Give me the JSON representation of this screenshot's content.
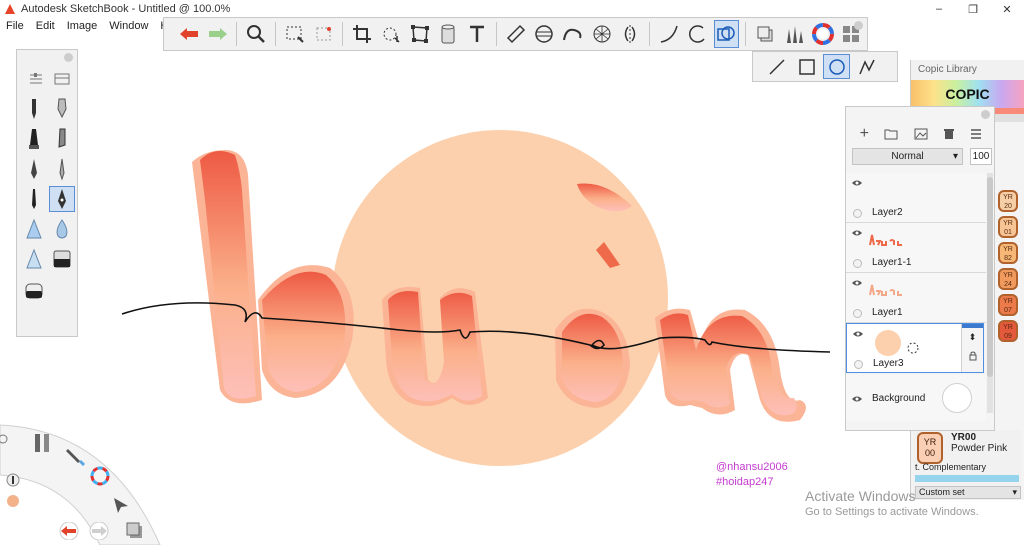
{
  "window": {
    "title": "Autodesk SketchBook - Untitled @ 100.0%",
    "controls": [
      "–",
      "❐",
      "✕"
    ]
  },
  "menu": [
    "File",
    "Edit",
    "Image",
    "Window",
    "Help"
  ],
  "toolbar": {
    "tools": [
      "undo-icon",
      "redo-icon",
      "zoom-icon",
      "rect-select-icon",
      "lasso-select-icon",
      "crop-icon",
      "transform-icon",
      "distort-icon",
      "fill-icon",
      "text-icon",
      "ruler-icon",
      "ellipse-guide-icon",
      "french-curve-icon",
      "perspective-icon",
      "symmetry-icon",
      "stroke-icon",
      "circle-icon",
      "shape-icon",
      "copy-icon",
      "brush-library-icon",
      "color-wheel-icon",
      "palette-grid-icon"
    ],
    "active_tool": "shape-icon",
    "shape_options": [
      "line",
      "rectangle",
      "ellipse",
      "polyline"
    ],
    "active_shape": "ellipse"
  },
  "copic": {
    "header": "Copic Library",
    "logo": "COPIC",
    "swatches": [
      {
        "code": "YR",
        "num": "20",
        "color": "#f6cfa6"
      },
      {
        "code": "YR",
        "num": "01",
        "color": "#f7c495"
      },
      {
        "code": "YR",
        "num": "82",
        "color": "#f6b777"
      },
      {
        "code": "YR",
        "num": "24",
        "color": "#f09a5e"
      },
      {
        "code": "YR",
        "num": "07",
        "color": "#ec7a4a"
      },
      {
        "code": "YR",
        "num": "09",
        "color": "#e4593b"
      }
    ],
    "current": {
      "code": "YR",
      "num": "00",
      "name": "YR00",
      "subname": "Powder Pink",
      "complementary": "t. Complementary",
      "set": "Custom set",
      "color": "#fbcfb3"
    }
  },
  "layers": {
    "blend_mode": "Normal",
    "opacity": "100",
    "items": [
      {
        "name": "Layer2",
        "active": false
      },
      {
        "name": "Layer1-1",
        "active": false
      },
      {
        "name": "Layer1",
        "active": false
      },
      {
        "name": "Layer3",
        "active": true
      },
      {
        "name": "Background",
        "active": false
      }
    ]
  },
  "watermark": [
    "@nhansu2006",
    "#hoidap247"
  ],
  "activate": {
    "line1": "Activate Windows",
    "line2": "Go to Settings to activate Windows."
  },
  "colors": {
    "accent": "#5a8ed4",
    "peach_circle": "#fcd0ac",
    "letter_top": "#ee5a44",
    "letter_bottom": "#fbb8a6",
    "ink": "#111111",
    "watermark": "#c43ad0"
  }
}
